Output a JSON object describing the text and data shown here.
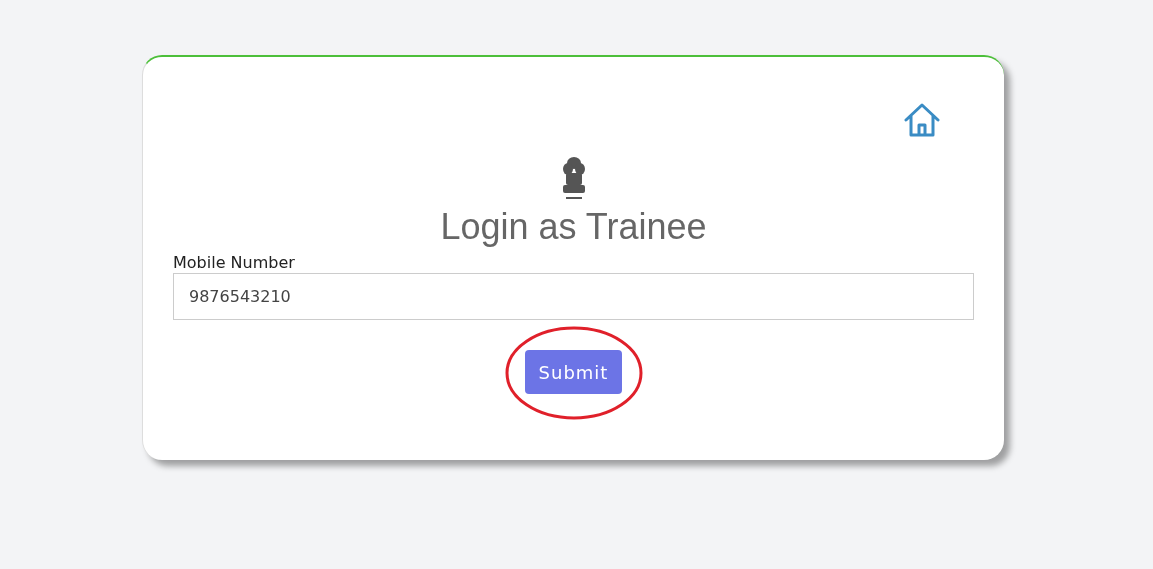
{
  "title": "Login as Trainee",
  "form": {
    "label": "Mobile Number",
    "value": "9876543210"
  },
  "submit": {
    "label": "Submit",
    "highlighted": true
  }
}
